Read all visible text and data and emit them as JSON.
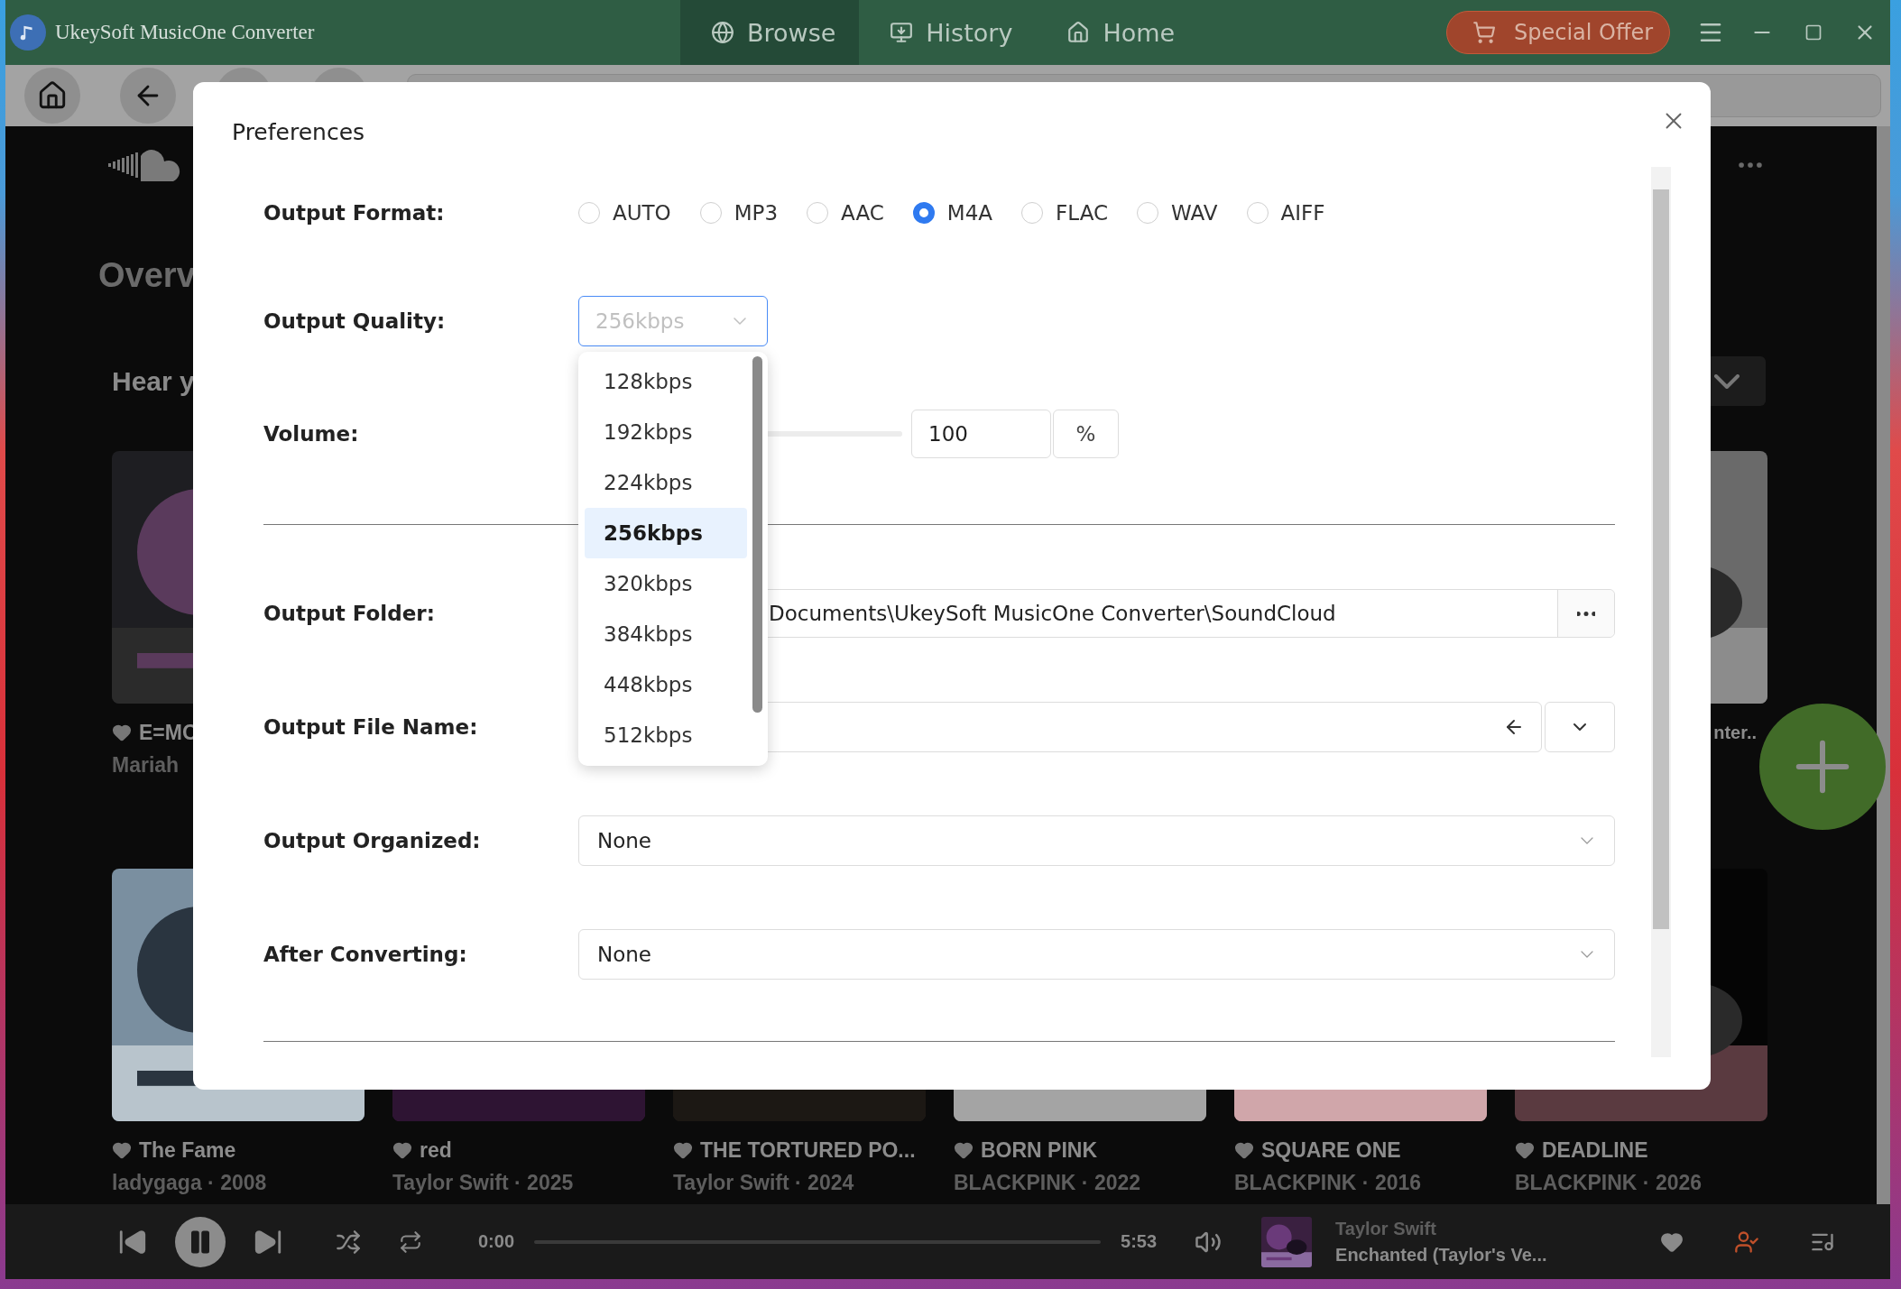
{
  "window": {
    "title": "UkeySoft MusicOne Converter"
  },
  "nav_tabs": [
    {
      "label": "Browse",
      "kind": "globe",
      "selected": true
    },
    {
      "label": "History",
      "kind": "download",
      "selected": false
    },
    {
      "label": "Home",
      "kind": "house",
      "selected": false
    }
  ],
  "special_offer": "Special Offer",
  "browser": {
    "heading": "Overv",
    "subheading": "Hear y",
    "row_1": [
      {
        "title": "E=MC",
        "subtitle": "Mariah"
      },
      {
        "title": "nter.."
      }
    ],
    "row_2": [
      {
        "title": "The Fame",
        "subtitle": "ladygaga · 2008"
      },
      {
        "title": "red",
        "subtitle": "Taylor Swift · 2025"
      },
      {
        "title": "THE TORTURED PO...",
        "subtitle": "Taylor Swift · 2024"
      },
      {
        "title": "BORN PINK",
        "subtitle": "BLACKPINK · 2022"
      },
      {
        "title": "SQUARE ONE",
        "subtitle": "BLACKPINK · 2016"
      },
      {
        "title": "DEADLINE",
        "subtitle": "BLACKPINK · 2026"
      }
    ]
  },
  "player": {
    "elapsed": "0:00",
    "duration": "5:53",
    "level": 0,
    "artist": "Taylor Swift",
    "track": "Enchanted (Taylor's Ve..."
  },
  "dialog": {
    "title": "Preferences",
    "output_format": {
      "label": "Output Format:",
      "options": [
        {
          "label": "AUTO",
          "selected": false
        },
        {
          "label": "MP3",
          "selected": false
        },
        {
          "label": "AAC",
          "selected": false
        },
        {
          "label": "M4A",
          "selected": true
        },
        {
          "label": "FLAC",
          "selected": false
        },
        {
          "label": "WAV",
          "selected": false
        },
        {
          "label": "AIFF",
          "selected": false
        }
      ]
    },
    "output_quality": {
      "label": "Output Quality:",
      "value": "256kbps",
      "options": [
        {
          "label": "128kbps",
          "selected": false
        },
        {
          "label": "192kbps",
          "selected": false
        },
        {
          "label": "224kbps",
          "selected": false
        },
        {
          "label": "256kbps",
          "selected": true
        },
        {
          "label": "320kbps",
          "selected": false
        },
        {
          "label": "384kbps",
          "selected": false
        },
        {
          "label": "448kbps",
          "selected": false
        },
        {
          "label": "512kbps",
          "selected": false
        }
      ]
    },
    "volume": {
      "label": "Volume:",
      "level": 1,
      "value": "100",
      "unit": "%"
    },
    "output_folder": {
      "label": "Output Folder:",
      "value": "Documents\\UkeySoft MusicOne Converter\\SoundCloud"
    },
    "output_file_name": {
      "label": "Output File Name:"
    },
    "output_organized": {
      "label": "Output Organized:",
      "value": "None"
    },
    "after_converting": {
      "label": "After Converting:",
      "value": "None"
    }
  }
}
